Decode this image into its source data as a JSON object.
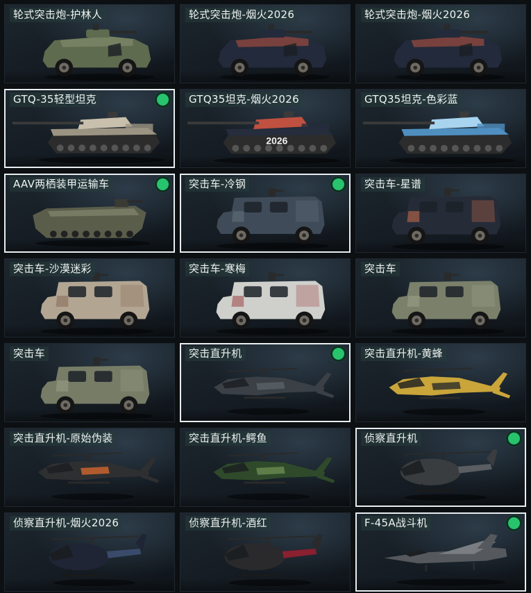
{
  "cards": [
    {
      "title": "轮式突击炮-护林人",
      "type": "wheeled",
      "color": "#5e6b4e",
      "accent": "#8a9272",
      "selected": false,
      "equipped": false
    },
    {
      "title": "轮式突击炮-烟火2026",
      "type": "wheeled",
      "color": "#222a3c",
      "accent": "#c0543e",
      "selected": false,
      "equipped": false
    },
    {
      "title": "轮式突击炮-烟火2026",
      "type": "wheeled",
      "color": "#222a3c",
      "accent": "#c0543e",
      "selected": false,
      "equipped": false
    },
    {
      "title": "GTQ-35轻型坦克",
      "type": "tank",
      "color": "#9c9482",
      "accent": "#c8c0ac",
      "selected": true,
      "equipped": true
    },
    {
      "title": "GTQ35坦克-烟火2026",
      "type": "tank",
      "color": "#262d3d",
      "accent": "#c05040",
      "decal": "2026",
      "selected": false,
      "equipped": false
    },
    {
      "title": "GTQ35坦克-色彩蓝",
      "type": "tank",
      "color": "#4f8fc0",
      "accent": "#a8d4f0",
      "selected": false,
      "equipped": false
    },
    {
      "title": "AAV两栖装甲运输车",
      "type": "aav",
      "color": "#5a5d4a",
      "accent": "#787b64",
      "selected": true,
      "equipped": true
    },
    {
      "title": "突击车-冷钢",
      "type": "assault",
      "color": "#3f4b58",
      "accent": "#62707c",
      "selected": true,
      "equipped": true
    },
    {
      "title": "突击车-星谱",
      "type": "assault",
      "color": "#262b38",
      "accent": "#c06a4a",
      "selected": false,
      "equipped": false
    },
    {
      "title": "突击车-沙漠迷彩",
      "type": "assault",
      "color": "#b2a592",
      "accent": "#8a6c5a",
      "selected": false,
      "equipped": false
    },
    {
      "title": "突击车-寒梅",
      "type": "assault",
      "color": "#cfd0cc",
      "accent": "#a05050",
      "selected": false,
      "equipped": false
    },
    {
      "title": "突击车",
      "type": "assault",
      "color": "#7a806a",
      "accent": "#9aa086",
      "selected": false,
      "equipped": false
    },
    {
      "title": "突击车",
      "type": "assault",
      "color": "#767c66",
      "accent": "#989e84",
      "selected": false,
      "equipped": false
    },
    {
      "title": "突击直升机",
      "type": "attack-heli",
      "color": "#3a4046",
      "accent": "#5a6268",
      "selected": true,
      "equipped": true
    },
    {
      "title": "突击直升机-黄蜂",
      "type": "attack-heli",
      "color": "#c9a53a",
      "accent": "#2a2a2a",
      "selected": false,
      "equipped": false
    },
    {
      "title": "突击直升机-原始伪装",
      "type": "attack-heli",
      "color": "#2e2f31",
      "accent": "#d0672e",
      "selected": false,
      "equipped": false
    },
    {
      "title": "突击直升机-鳄鱼",
      "type": "attack-heli",
      "color": "#2f4a2a",
      "accent": "#6a8a50",
      "selected": false,
      "equipped": false
    },
    {
      "title": "侦察直升机",
      "type": "scout-heli",
      "color": "#3a3d40",
      "accent": "#5a5e62",
      "selected": true,
      "equipped": true
    },
    {
      "title": "侦察直升机-烟火2026",
      "type": "scout-heli",
      "color": "#1f2535",
      "accent": "#3a4a6a",
      "selected": false,
      "equipped": false
    },
    {
      "title": "侦察直升机-酒红",
      "type": "scout-heli",
      "color": "#2a2a2c",
      "accent": "#8a2030",
      "selected": false,
      "equipped": false
    },
    {
      "title": "F-45A战斗机",
      "type": "jet",
      "color": "#55595d",
      "accent": "#7a7e82",
      "selected": true,
      "equipped": true
    }
  ]
}
